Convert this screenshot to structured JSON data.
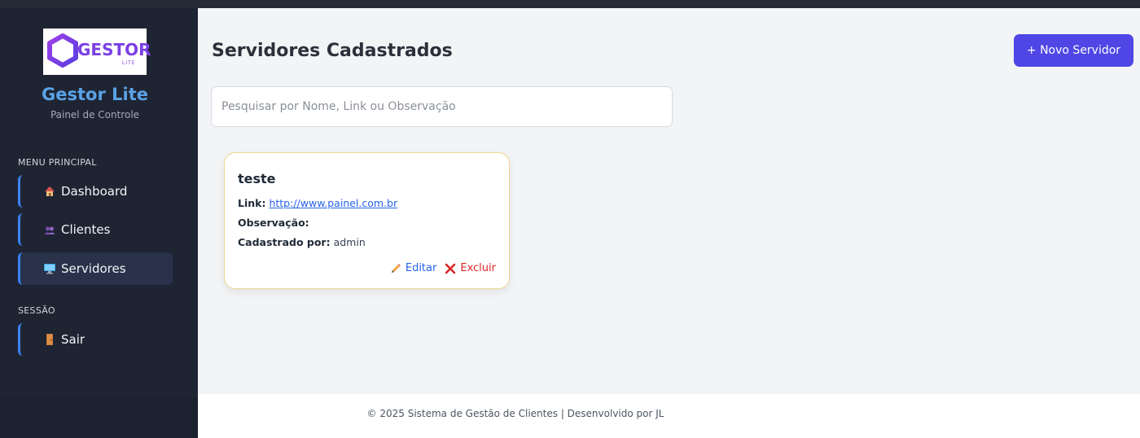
{
  "brand": {
    "logo_text": "GESTOR",
    "logo_sub": "LITE",
    "name": "Gestor Lite",
    "subtitle": "Painel de Controle"
  },
  "menu": {
    "main_label": "MENU PRINCIPAL",
    "items": [
      {
        "label": "Dashboard",
        "icon": "house-icon"
      },
      {
        "label": "Clientes",
        "icon": "users-icon"
      },
      {
        "label": "Servidores",
        "icon": "monitor-icon",
        "active": true
      }
    ],
    "session_label": "SESSÃO",
    "session_items": [
      {
        "label": "Sair",
        "icon": "door-icon"
      }
    ]
  },
  "page": {
    "title": "Servidores Cadastrados",
    "new_button": "+ Novo Servidor",
    "search_placeholder": "Pesquisar por Nome, Link ou Observação"
  },
  "servers": [
    {
      "name": "teste",
      "link_label": "Link:",
      "link": "http://www.painel.com.br",
      "obs_label": "Observação:",
      "obs": "",
      "created_label": "Cadastrado por:",
      "created_by": "admin",
      "edit_label": "Editar",
      "delete_label": "Excluir"
    }
  ],
  "footer": {
    "text": "© 2025 Sistema de Gestão de Clientes | Desenvolvido por JL"
  },
  "colors": {
    "sidebar_bg": "#1f2433",
    "accent": "#4f46e5",
    "brand_blue": "#5aa2e6",
    "nav_border": "#3b82f6"
  }
}
